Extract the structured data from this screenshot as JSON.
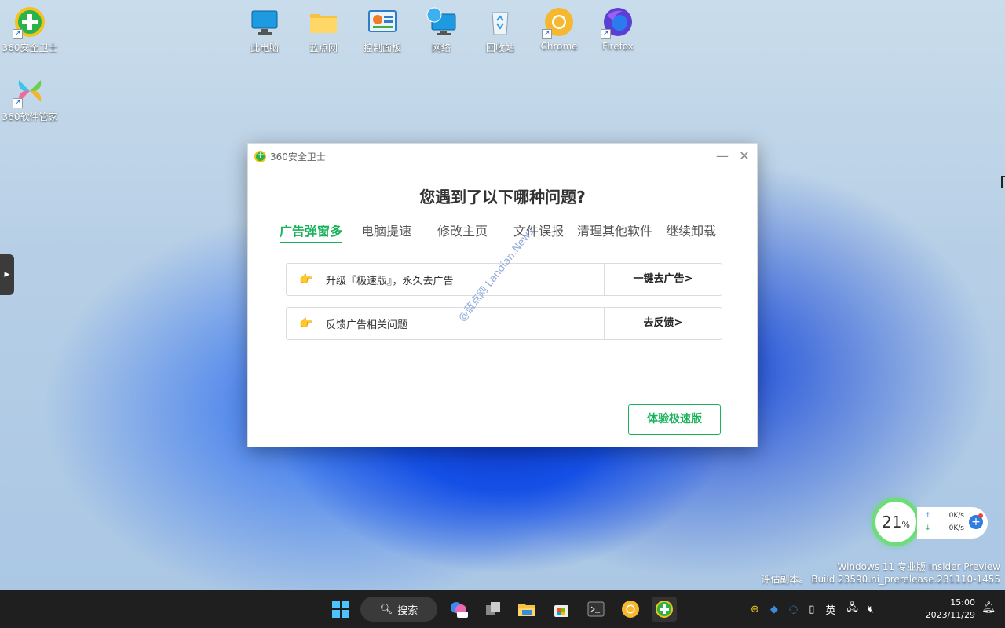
{
  "desktop": {
    "icons": [
      {
        "label": "360安全卫士"
      },
      {
        "label": "360软件管家"
      },
      {
        "label": "此电脑"
      },
      {
        "label": "蓝点网"
      },
      {
        "label": "控制面板"
      },
      {
        "label": "网络"
      },
      {
        "label": "回收站"
      },
      {
        "label": "Chrome"
      },
      {
        "label": "Firefox"
      }
    ]
  },
  "dialog": {
    "app_title": "360安全卫士",
    "minimize": "—",
    "close": "✕",
    "heading": "您遇到了以下哪种问题?",
    "tabs": [
      "广告弹窗多",
      "电脑提速",
      "修改主页",
      "文件误报",
      "清理其他软件",
      "继续卸载"
    ],
    "active_tab": "广告弹窗多",
    "options": [
      {
        "hand": "👉",
        "text": "升级『极速版』，永久去广告",
        "action": "一键去广告>"
      },
      {
        "hand": "👉",
        "text": "反馈广告相关问题",
        "action": "去反馈>"
      }
    ],
    "watermark": "@蓝点网 Landian.News",
    "trial_button": "体验极速版"
  },
  "net_widget": {
    "percent": "21",
    "percent_sign": "%",
    "up_speed": "0K/s",
    "down_speed": "0K/s"
  },
  "os_watermark": {
    "line1": "Windows 11 专业版 Insider Preview",
    "line2": "评估副本。 Build 23590.ni_prerelease.231110-1455"
  },
  "taskbar": {
    "search_label": "搜索",
    "ime": "英",
    "time": "15:00",
    "date": "2023/11/29"
  },
  "colors": {
    "accent": "#19b25a",
    "taskbar_bg": "#1f1f1f"
  }
}
